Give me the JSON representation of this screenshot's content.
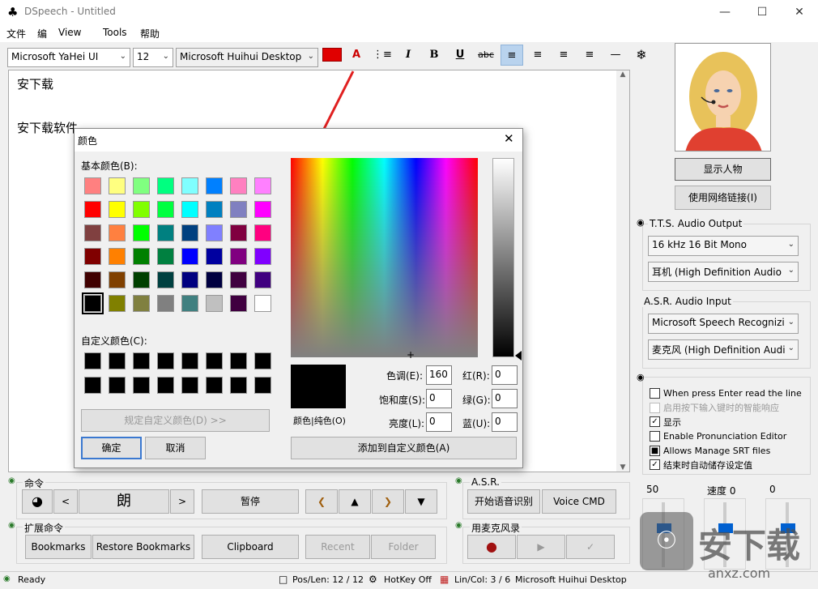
{
  "window": {
    "title": "DSpeech - Untitled",
    "minimize": "—",
    "maximize": "☐",
    "close": "✕"
  },
  "menu": [
    "文件",
    "编",
    "View",
    "Tools",
    "帮助"
  ],
  "toolbar": {
    "font": "Microsoft YaHei UI",
    "size": "12",
    "voice": "Microsoft Huihui Desktop"
  },
  "editor": {
    "lines": [
      "安下载",
      "安下载软件"
    ]
  },
  "avatar": {
    "show_btn": "显示人物",
    "web_btn": "使用网络链接(I)"
  },
  "tts": {
    "title": "T.T.S. Audio Output",
    "format": "16 kHz 16 Bit Mono",
    "device": "耳机 (High Definition Audio"
  },
  "asr_input": {
    "title": "A.S.R. Audio Input",
    "engine": "Microsoft Speech Recognizi",
    "device": "麦克风 (High Definition Audi"
  },
  "options": [
    {
      "label": "When press Enter read the line",
      "checked": false,
      "disabled": false
    },
    {
      "label": "启用按下输入键时的智能响应",
      "checked": false,
      "disabled": true
    },
    {
      "label": "显示",
      "checked": true,
      "disabled": false
    },
    {
      "label": "Enable Pronunciation Editor",
      "checked": false,
      "disabled": false
    },
    {
      "label": "Allows Manage SRT files",
      "checked": true,
      "disabled": false
    },
    {
      "label": "结束时自动储存设定值",
      "checked": true,
      "disabled": false
    }
  ],
  "sliders": {
    "rate_value": "50",
    "speed_label": "速度 0",
    "volume_value": "0"
  },
  "commands": {
    "title": "命令",
    "read": "朗",
    "pause": "暂停"
  },
  "ext": {
    "title": "扩展命令",
    "bookmarks": "Bookmarks",
    "restore": "Restore Bookmarks",
    "clipboard": "Clipboard",
    "recent": "Recent",
    "folder": "Folder"
  },
  "asr": {
    "title": "A.S.R.",
    "start": "开始语音识别",
    "voice_cmd": "Voice CMD"
  },
  "mic": {
    "title": "用麦克风录"
  },
  "status": {
    "ready": "Ready",
    "poslen": "Pos/Len: 12 / 12",
    "hotkey": "HotKey Off",
    "lincol": "Lin/Col: 3 / 6",
    "voice": "Microsoft Huihui Desktop"
  },
  "watermark": {
    "brand": "安下载",
    "domain": "anxz.com"
  },
  "dialog": {
    "title": "颜色",
    "basic_label": "基本颜色(B):",
    "custom_label": "自定义颜色(C):",
    "define_btn": "规定自定义颜色(D) >>",
    "ok": "确定",
    "cancel": "取消",
    "color_solid": "颜色|纯色(O)",
    "add_custom": "添加到自定义颜色(A)",
    "hue_label": "色调(E):",
    "hue": "160",
    "sat_label": "饱和度(S):",
    "sat": "0",
    "lum_label": "亮度(L):",
    "lum": "0",
    "red_label": "红(R):",
    "red": "0",
    "green_label": "绿(G):",
    "green": "0",
    "blue_label": "蓝(U):",
    "blue": "0",
    "basic_colors": [
      "#ff8080",
      "#ffff80",
      "#80ff80",
      "#00ff80",
      "#80ffff",
      "#0080ff",
      "#ff80c0",
      "#ff80ff",
      "#ff0000",
      "#ffff00",
      "#80ff00",
      "#00ff40",
      "#00ffff",
      "#0080c0",
      "#8080c0",
      "#ff00ff",
      "#804040",
      "#ff8040",
      "#00ff00",
      "#008080",
      "#004080",
      "#8080ff",
      "#800040",
      "#ff0080",
      "#800000",
      "#ff8000",
      "#008000",
      "#008040",
      "#0000ff",
      "#0000a0",
      "#800080",
      "#8000ff",
      "#400000",
      "#804000",
      "#004000",
      "#004040",
      "#000080",
      "#000040",
      "#400040",
      "#400080",
      "#000000",
      "#808000",
      "#808040",
      "#808080",
      "#408080",
      "#c0c0c0",
      "#400040",
      "#ffffff"
    ]
  }
}
